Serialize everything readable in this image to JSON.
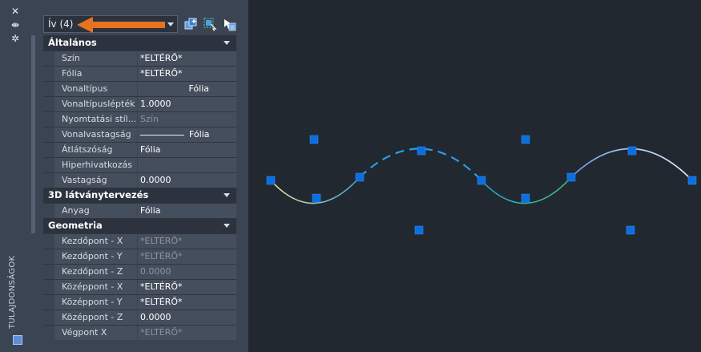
{
  "palette": {
    "title": "TULAJDONSÁGOK",
    "selector": {
      "value": "Ív (4)"
    },
    "sections": [
      {
        "title": "Általános",
        "rows": [
          {
            "name": "Szín",
            "value": "*ELTÉRŐ*"
          },
          {
            "name": "Fólia",
            "value": "*ELTÉRŐ*"
          },
          {
            "name": "Vonaltípus",
            "value": "Fólia"
          },
          {
            "name": "Vonaltípuslépték",
            "value": "1.0000"
          },
          {
            "name": "Nyomtatási stíl...",
            "value": "Szín"
          },
          {
            "name": "Vonalvastagság",
            "value": "Fólia"
          },
          {
            "name": "Átlátszóság",
            "value": "Fólia"
          },
          {
            "name": "Hiperhivatkozás",
            "value": ""
          },
          {
            "name": "Vastagság",
            "value": "0.0000"
          }
        ]
      },
      {
        "title": "3D látványtervezés",
        "rows": [
          {
            "name": "Anyag",
            "value": "Fólia"
          }
        ]
      },
      {
        "title": "Geometria",
        "rows": [
          {
            "name": "Kezdőpont - X",
            "value": "*ELTÉRŐ*"
          },
          {
            "name": "Kezdőpont - Y",
            "value": "*ELTÉRŐ*"
          },
          {
            "name": "Kezdőpont - Z",
            "value": "0.0000"
          },
          {
            "name": "Középpont - X",
            "value": "*ELTÉRŐ*"
          },
          {
            "name": "Középpont - Y",
            "value": "*ELTÉRŐ*"
          },
          {
            "name": "Középpont - Z",
            "value": "0.0000"
          },
          {
            "name": "Végpont X",
            "value": "*ELTÉRŐ*"
          }
        ]
      }
    ]
  },
  "colors": {
    "annotation_arrow": "#e8731e",
    "grip": "#0b6fe0",
    "selected_dashed": "#2b9ce8",
    "arc_gradient_start": "#e8e8a0",
    "arc_gradient_end": "#38a8d8"
  }
}
